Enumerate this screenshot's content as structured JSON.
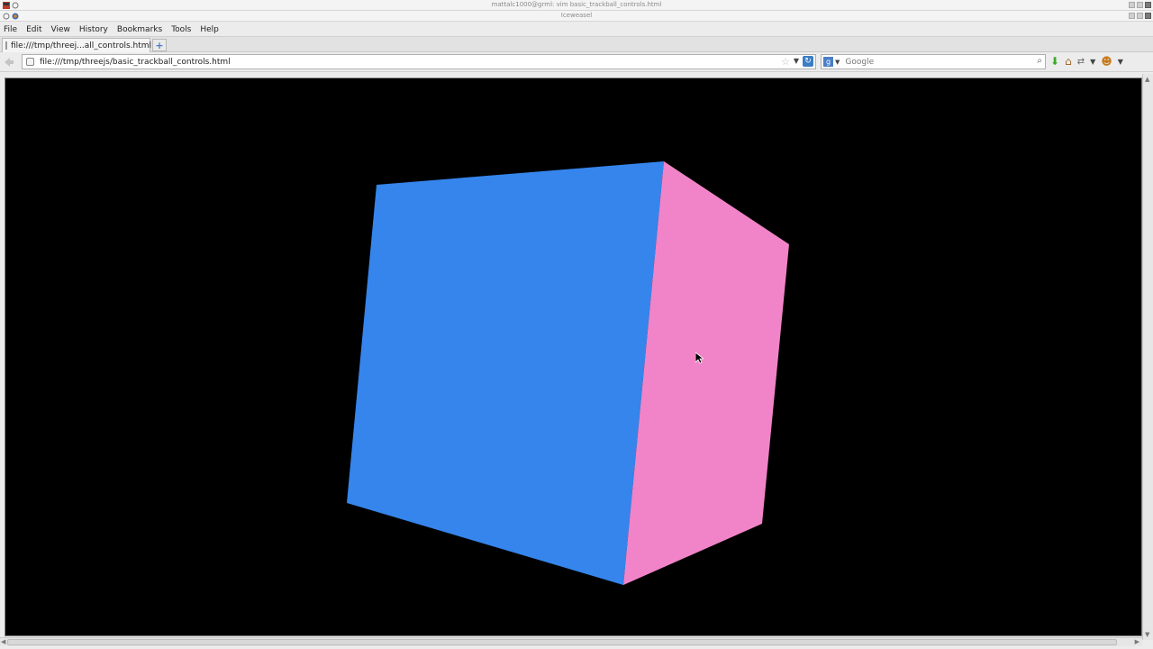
{
  "os_window": {
    "title": "mattalc1000@grml: vim basic_trackball_controls.html"
  },
  "browser_window": {
    "title": "Iceweasel"
  },
  "menu": {
    "items": [
      "File",
      "Edit",
      "View",
      "History",
      "Bookmarks",
      "Tools",
      "Help"
    ]
  },
  "tab": {
    "label": "file:///tmp/threej...all_controls.html"
  },
  "url": {
    "value": "file:///tmp/threejs/basic_trackball_controls.html"
  },
  "search": {
    "placeholder": "Google",
    "engine_icon": "google-icon"
  },
  "toolbar_icons": [
    "download-icon",
    "home-icon",
    "switch-icon",
    "monkey-icon"
  ],
  "scene": {
    "background": "#000000",
    "cube_front_color": "#3585ed",
    "cube_side_color": "#f184c8"
  }
}
